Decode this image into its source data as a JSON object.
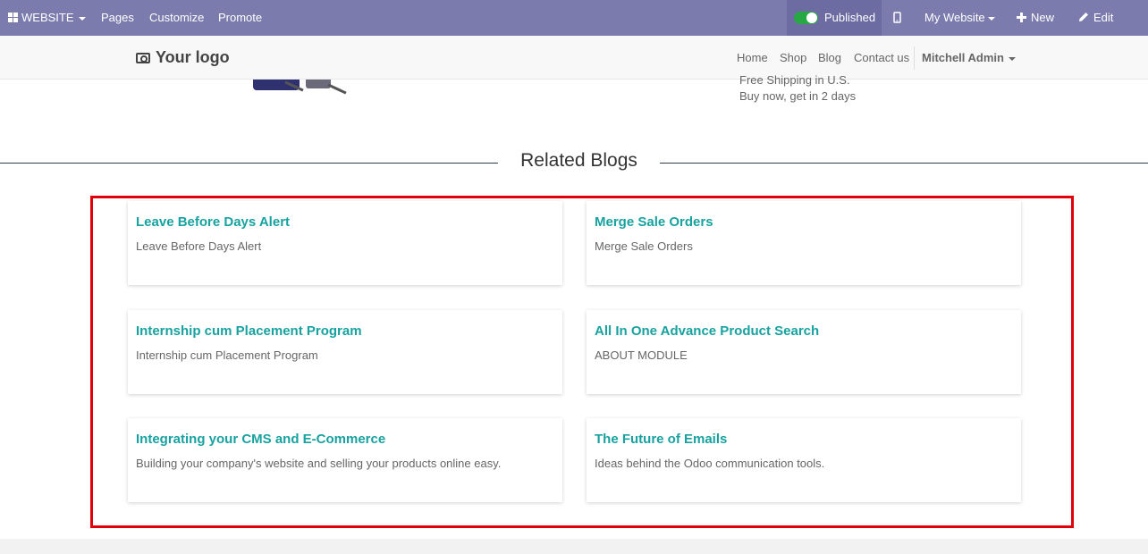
{
  "topbar": {
    "website_menu": "WEBSITE",
    "pages": "Pages",
    "customize": "Customize",
    "promote": "Promote",
    "published": "Published",
    "my_website": "My Website",
    "new": "New",
    "edit": "Edit"
  },
  "navbar": {
    "logo": "Your logo",
    "links": [
      "Home",
      "Shop",
      "Blog",
      "Contact us"
    ],
    "user": "Mitchell Admin"
  },
  "product": {
    "shipping": "Free Shipping in U.S.",
    "delivery": "Buy now, get in 2 days"
  },
  "related_blogs": {
    "heading": "Related Blogs",
    "cards": [
      {
        "title": "Leave Before Days Alert",
        "description": "Leave Before Days Alert"
      },
      {
        "title": "Merge Sale Orders",
        "description": "Merge Sale Orders"
      },
      {
        "title": "Internship cum Placement Program",
        "description": "Internship cum Placement Program"
      },
      {
        "title": "All In One Advance Product Search",
        "description": "ABOUT MODULE"
      },
      {
        "title": "Integrating your CMS and E-Commerce",
        "description": "Building your company's website and selling your products online easy."
      },
      {
        "title": "The Future of Emails",
        "description": "Ideas behind the Odoo communication tools."
      }
    ]
  },
  "colors": {
    "topbar": "#7c7bad",
    "link_teal": "#17a2a0",
    "highlight_red": "#e0000a",
    "toggle_green": "#28a745"
  },
  "icons": [
    "apps-grid-icon",
    "mobile-icon",
    "plus-icon",
    "pencil-icon",
    "camera-icon"
  ]
}
